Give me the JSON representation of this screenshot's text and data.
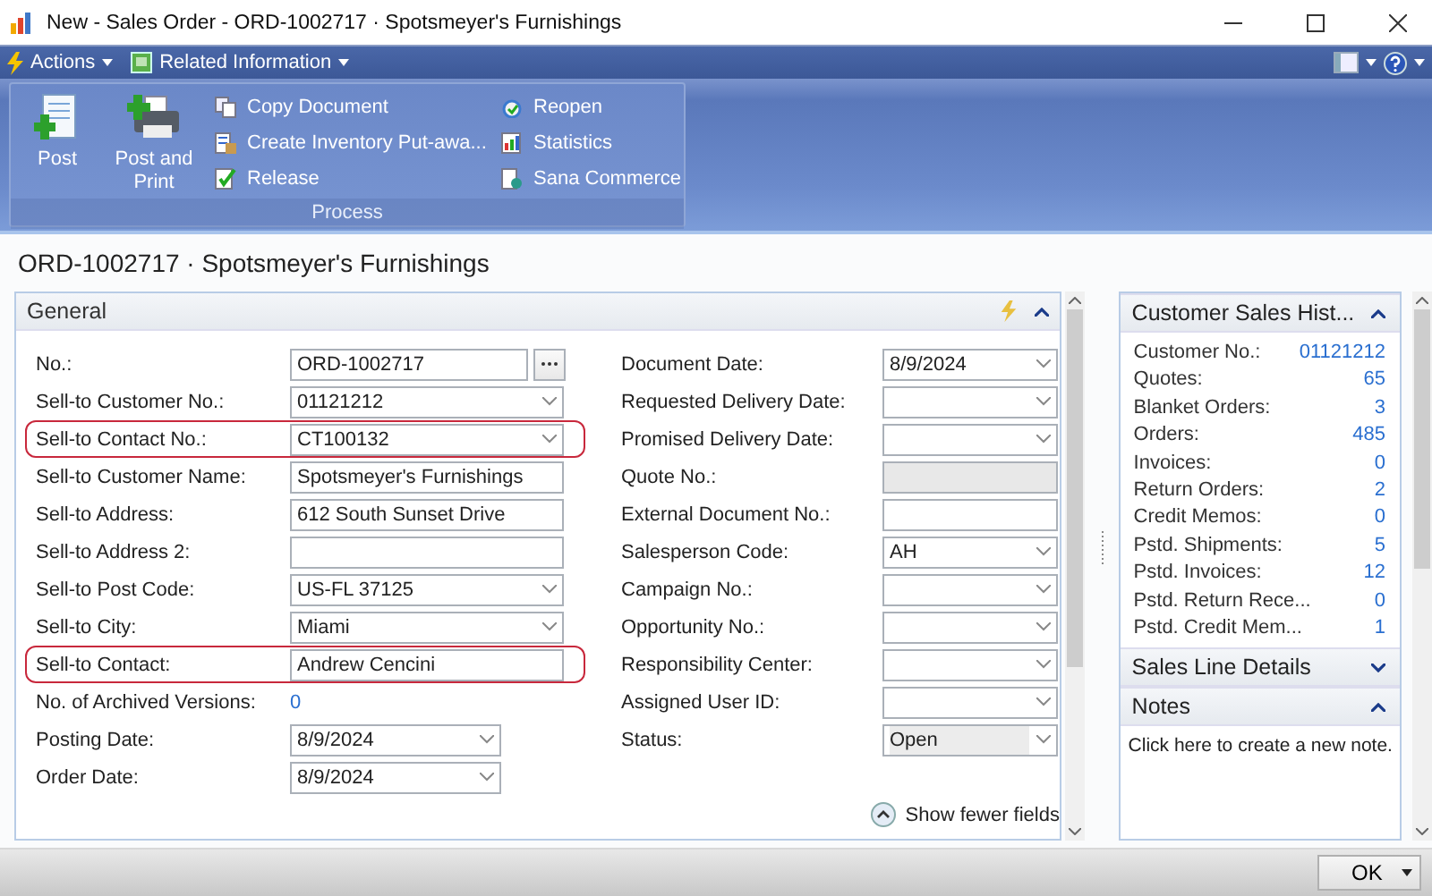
{
  "window": {
    "title": "New - Sales Order - ORD-1002717 · Spotsmeyer's Furnishings"
  },
  "menu": [
    {
      "label": "Actions",
      "kind": "actions"
    },
    {
      "label": "Related Information",
      "kind": "related"
    }
  ],
  "ribbon": {
    "group": "Process",
    "large_actions": [
      {
        "label": "Post",
        "kind": "post"
      },
      {
        "label": "Post and Print",
        "kind": "print"
      }
    ],
    "small_actions": [
      {
        "label": "Copy Document",
        "kind": "copy"
      },
      {
        "label": "Create Inventory Put-awa...",
        "kind": "inventory"
      },
      {
        "label": "Release",
        "kind": "release"
      },
      {
        "label": "Reopen",
        "kind": "reopen"
      },
      {
        "label": "Statistics",
        "kind": "statistics"
      },
      {
        "label": "Sana Commerce",
        "kind": "sana"
      }
    ]
  },
  "page_title": "ORD-1002717 · Spotsmeyer's Furnishings",
  "general": {
    "title": "General",
    "link": "Show fewer fields",
    "left_fields": [
      {
        "label": "No.:",
        "value": "ORD-1002717",
        "kind": "lookup",
        "highlighted": false
      },
      {
        "label": "Sell-to Customer No.:",
        "value": "01121212",
        "kind": "combo",
        "highlighted": false
      },
      {
        "label": "Sell-to Contact No.:",
        "value": "CT100132",
        "kind": "combo",
        "highlighted": true
      },
      {
        "label": "Sell-to Customer Name:",
        "value": "Spotsmeyer's Furnishings",
        "kind": "text",
        "highlighted": false
      },
      {
        "label": "Sell-to Address:",
        "value": "612 South Sunset Drive",
        "kind": "text",
        "highlighted": false
      },
      {
        "label": "Sell-to Address 2:",
        "kind": "text",
        "highlighted": false
      },
      {
        "label": "Sell-to Post Code:",
        "value": "US-FL 37125",
        "kind": "combo",
        "highlighted": false
      },
      {
        "label": "Sell-to City:",
        "value": "Miami",
        "kind": "combo",
        "highlighted": false
      },
      {
        "label": "Sell-to Contact:",
        "value": "Andrew Cencini",
        "kind": "text",
        "highlighted": true
      },
      {
        "label": "No. of Archived Versions:",
        "value": "0",
        "kind": "link",
        "highlighted": false
      },
      {
        "label": "Posting Date:",
        "value": "8/9/2024",
        "kind": "short-combo",
        "highlighted": false
      },
      {
        "label": "Order Date:",
        "value": "8/9/2024",
        "kind": "short-combo",
        "highlighted": false
      }
    ],
    "right_fields": [
      {
        "label": "Document Date:",
        "value": "8/9/2024",
        "kind": "combo",
        "highlighted": false
      },
      {
        "label": "Requested Delivery Date:",
        "kind": "combo",
        "highlighted": false
      },
      {
        "label": "Promised Delivery Date:",
        "kind": "combo",
        "highlighted": false
      },
      {
        "label": "Quote No.:",
        "kind": "disabled",
        "highlighted": false
      },
      {
        "label": "External Document No.:",
        "kind": "text",
        "highlighted": false
      },
      {
        "label": "Salesperson Code:",
        "value": "AH",
        "kind": "combo",
        "highlighted": false
      },
      {
        "label": "Campaign No.:",
        "kind": "combo",
        "highlighted": false
      },
      {
        "label": "Opportunity No.:",
        "kind": "combo",
        "highlighted": false
      },
      {
        "label": "Responsibility Center:",
        "kind": "combo",
        "highlighted": false
      },
      {
        "label": "Assigned User ID:",
        "kind": "combo",
        "highlighted": false
      },
      {
        "label": "Status:",
        "value": "Open",
        "kind": "status",
        "highlighted": false
      }
    ]
  },
  "factboxes": [
    {
      "title": "Customer Sales Hist...",
      "expanded": true,
      "rows": [
        {
          "label": "Customer No.:",
          "value": "01121212"
        },
        {
          "label": "Quotes:",
          "value": "65"
        },
        {
          "label": "Blanket Orders:",
          "value": "3"
        },
        {
          "label": "Orders:",
          "value": "485"
        },
        {
          "label": "Invoices:",
          "value": "0"
        },
        {
          "label": "Return Orders:",
          "value": "2"
        },
        {
          "label": "Credit Memos:",
          "value": "0"
        },
        {
          "label": "Pstd. Shipments:",
          "value": "5"
        },
        {
          "label": "Pstd. Invoices:",
          "value": "12"
        },
        {
          "label": "Pstd. Return Rece...",
          "value": "0"
        },
        {
          "label": "Pstd. Credit Mem...",
          "value": "1"
        }
      ]
    },
    {
      "title": "Sales Line Details",
      "expanded": false
    },
    {
      "title": "Notes",
      "expanded": true,
      "text": "Click here to create a new note."
    }
  ],
  "ok_button": "OK"
}
